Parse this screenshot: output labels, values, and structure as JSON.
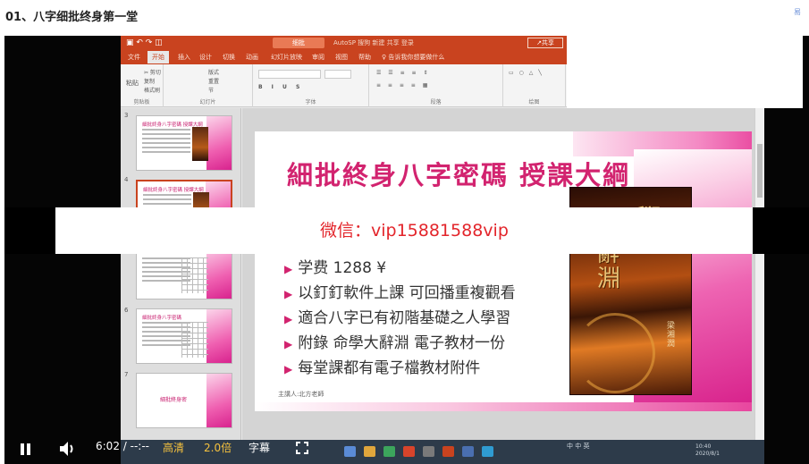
{
  "page": {
    "title": "01、八字细批终身第一堂",
    "corner_mark": "易"
  },
  "recording": {
    "titlebar": {
      "doc_name": "细批",
      "tools": "AutoSP  搜狗  新建  共享  登录",
      "share": "↗共享"
    },
    "tabs": [
      "文件",
      "开始",
      "插入",
      "设计",
      "切换",
      "动画",
      "幻灯片放映",
      "审阅",
      "视图",
      "帮助"
    ],
    "tab_search": "♀ 告诉我你想要做什么",
    "ribbon_groups": [
      "剪贴板",
      "幻灯片",
      "字体",
      "段落",
      "绘图",
      "编辑"
    ],
    "ribbon_items": {
      "paste": "粘贴",
      "new_slide": "新建\n幻灯片",
      "cut": "✂ 剪切",
      "copy": "复制",
      "format_painter": "格式刷",
      "layout": "版式",
      "reset": "重置",
      "section": "节"
    },
    "slide_numbers": [
      "3",
      "4",
      "5",
      "6",
      "7"
    ],
    "thumbs": [
      {
        "title": "細批終身八字密碼 授課大綱"
      },
      {
        "title": "細批終身八字密碼 授課大綱"
      },
      {
        "title": ""
      },
      {
        "title": "細批終身八字密碼"
      },
      {
        "title": "細批終身密"
      }
    ]
  },
  "slide": {
    "title": "細批終身八字密碼 授課大綱",
    "bullets": [
      "学费 1288 ¥",
      "以釘釘軟件上課 可回播重複觀看",
      "適合八字已有初階基礎之人學習",
      "附錄 命學大辭淵 電子教材一份",
      "每堂課都有電子檔教材附件"
    ],
    "footer": "主講人:北方老師",
    "book": {
      "chars": "學",
      "chars2": "辭淵",
      "author": "梁湘潤"
    }
  },
  "watermark": "微信：vip15881588vip",
  "edge_char": "n",
  "taskbar": {
    "ime": "中 中 英",
    "time": "10:40",
    "date": "2020/8/1"
  },
  "player": {
    "time": "6:02 / --:--",
    "quality": "高清",
    "speed": "2.0倍",
    "subtitles": "字幕"
  },
  "colors": {
    "accent_yellow": "#f6c23e",
    "ppt_orange": "#c9431f",
    "slide_pink": "#d2236f",
    "watermark_red": "#e3252b"
  }
}
